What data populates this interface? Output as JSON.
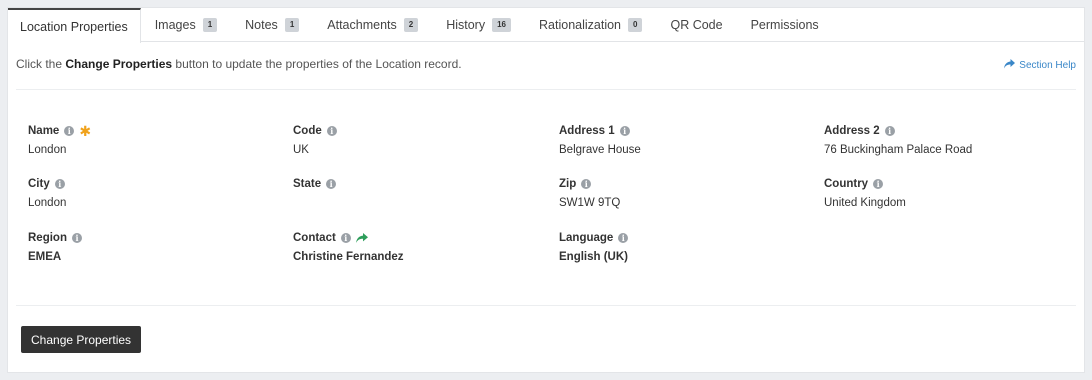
{
  "tabs": [
    {
      "label": "Location Properties",
      "badge": null
    },
    {
      "label": "Images",
      "badge": "1"
    },
    {
      "label": "Notes",
      "badge": "1"
    },
    {
      "label": "Attachments",
      "badge": "2"
    },
    {
      "label": "History",
      "badge": "16"
    },
    {
      "label": "Rationalization",
      "badge": "0"
    },
    {
      "label": "QR Code",
      "badge": null
    },
    {
      "label": "Permissions",
      "badge": null
    }
  ],
  "info": {
    "prefix": "Click the",
    "button_name": "Change Properties",
    "suffix": "button to update the properties of the Location record."
  },
  "section_help": {
    "label": "Section Help",
    "icon": "share-icon",
    "color": "#3a87c8"
  },
  "fields": {
    "name": {
      "label": "Name",
      "value": "London",
      "required": true
    },
    "code": {
      "label": "Code",
      "value": "UK"
    },
    "address1": {
      "label": "Address 1",
      "value": "Belgrave House"
    },
    "address2": {
      "label": "Address 2",
      "value": "76 Buckingham Palace Road"
    },
    "city": {
      "label": "City",
      "value": "London"
    },
    "state": {
      "label": "State",
      "value": ""
    },
    "zip": {
      "label": "Zip",
      "value": "SW1W 9TQ"
    },
    "country": {
      "label": "Country",
      "value": "United Kingdom"
    },
    "region": {
      "label": "Region",
      "value": "EMEA"
    },
    "contact": {
      "label": "Contact",
      "value": "Christine Fernandez",
      "link_icon_color": "#2e9e5b"
    },
    "language": {
      "label": "Language",
      "value": "English (UK)"
    }
  },
  "actions": {
    "change_properties_label": "Change Properties"
  },
  "colors": {
    "required": "#f0a21b",
    "button_bg": "#333333",
    "accent_link": "#3a87c8"
  }
}
